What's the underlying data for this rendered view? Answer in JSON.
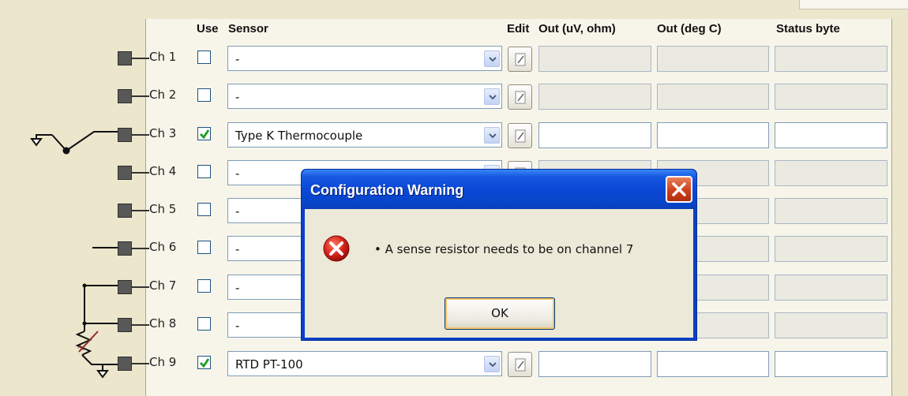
{
  "table": {
    "headers": {
      "use": "Use",
      "sensor": "Sensor",
      "edit": "Edit",
      "out_uv": "Out (uV, ohm)",
      "out_degc": "Out (deg C)",
      "status": "Status byte"
    },
    "channels": [
      {
        "label": "Ch 1",
        "use_checked": false,
        "sensor": "-",
        "active": false
      },
      {
        "label": "Ch 2",
        "use_checked": false,
        "sensor": "-",
        "active": false
      },
      {
        "label": "Ch 3",
        "use_checked": true,
        "sensor": "Type K Thermocouple",
        "active": true
      },
      {
        "label": "Ch 4",
        "use_checked": false,
        "sensor": "-",
        "active": false
      },
      {
        "label": "Ch 5",
        "use_checked": false,
        "sensor": "-",
        "active": false
      },
      {
        "label": "Ch 6",
        "use_checked": false,
        "sensor": "-",
        "active": false
      },
      {
        "label": "Ch 7",
        "use_checked": false,
        "sensor": "-",
        "active": false
      },
      {
        "label": "Ch 8",
        "use_checked": false,
        "sensor": "-",
        "active": false
      },
      {
        "label": "Ch 9",
        "use_checked": true,
        "sensor": "RTD PT-100",
        "active": true
      }
    ]
  },
  "dialog": {
    "title": "Configuration Warning",
    "message": "• A sense resistor needs to be on channel 7",
    "ok_label": "OK",
    "icon": "error-icon"
  },
  "colors": {
    "titlebar": "#0A47D6",
    "close": "#CF3F1A",
    "check": "#1E9B1E",
    "background": "#ECE6CC"
  }
}
